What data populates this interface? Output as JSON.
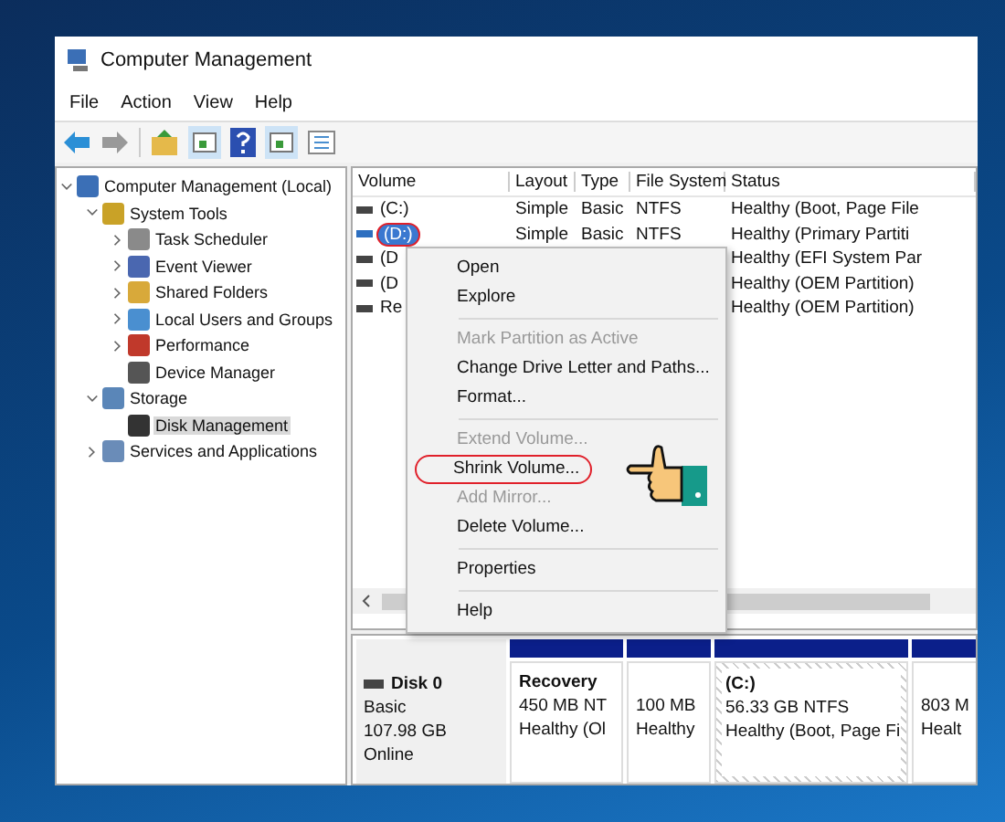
{
  "window": {
    "title": "Computer Management"
  },
  "menu": [
    "File",
    "Action",
    "View",
    "Help"
  ],
  "tree": [
    {
      "label": "Computer Management (Local)",
      "expanded": true,
      "selected": false,
      "children": [
        {
          "label": "System Tools",
          "expanded": true,
          "selected": false,
          "children": [
            {
              "label": "Task Scheduler",
              "expanded": false,
              "selected": false
            },
            {
              "label": "Event Viewer",
              "expanded": false,
              "selected": false
            },
            {
              "label": "Shared Folders",
              "expanded": false,
              "selected": false
            },
            {
              "label": "Local Users and Groups",
              "expanded": false,
              "selected": false
            },
            {
              "label": "Performance",
              "expanded": false,
              "selected": false
            },
            {
              "label": "Device Manager",
              "selected": false
            }
          ]
        },
        {
          "label": "Storage",
          "expanded": true,
          "selected": false,
          "children": [
            {
              "label": "Disk Management",
              "selected": true
            }
          ]
        },
        {
          "label": "Services and Applications",
          "expanded": false,
          "selected": false
        }
      ]
    }
  ],
  "table": {
    "columns": [
      "Volume",
      "Layout",
      "Type",
      "File System",
      "Status"
    ],
    "rows": [
      {
        "volume": "(C:)",
        "layout": "Simple",
        "type": "Basic",
        "file_system": "NTFS",
        "status": "Healthy (Boot, Page File",
        "selected": false,
        "circled": false
      },
      {
        "volume": "(D:)",
        "layout": "Simple",
        "type": "Basic",
        "file_system": "NTFS",
        "status": "Healthy (Primary Partiti",
        "selected": true,
        "circled": true
      },
      {
        "volume": "(D",
        "status": "Healthy (EFI System Par",
        "selected": false,
        "circled": false
      },
      {
        "volume": "(D",
        "status": "Healthy (OEM Partition)",
        "selected": false,
        "circled": false
      },
      {
        "volume": "Re",
        "status": "Healthy (OEM Partition)",
        "selected": false,
        "circled": false
      }
    ]
  },
  "context_menu": [
    {
      "kind": "item",
      "label": "Open",
      "disabled": false,
      "circled": false
    },
    {
      "kind": "item",
      "label": "Explore",
      "disabled": false,
      "circled": false
    },
    {
      "kind": "separator"
    },
    {
      "kind": "item",
      "label": "Mark Partition as Active",
      "disabled": true,
      "circled": false
    },
    {
      "kind": "item",
      "label": "Change Drive Letter and Paths...",
      "disabled": false,
      "circled": false
    },
    {
      "kind": "item",
      "label": "Format...",
      "disabled": false,
      "circled": false
    },
    {
      "kind": "separator"
    },
    {
      "kind": "item",
      "label": "Extend Volume...",
      "disabled": true,
      "circled": false
    },
    {
      "kind": "item",
      "label": "Shrink Volume...",
      "disabled": false,
      "circled": true
    },
    {
      "kind": "item",
      "label": "Add Mirror...",
      "disabled": true,
      "circled": false
    },
    {
      "kind": "item",
      "label": "Delete Volume...",
      "disabled": false,
      "circled": false
    },
    {
      "kind": "separator"
    },
    {
      "kind": "item",
      "label": "Properties",
      "disabled": false,
      "circled": false
    },
    {
      "kind": "separator"
    },
    {
      "kind": "item",
      "label": "Help",
      "disabled": false,
      "circled": false
    }
  ],
  "disk": {
    "name": "Disk 0",
    "lines": [
      "Basic",
      "107.98 GB",
      "Online"
    ],
    "partitions": [
      {
        "title": "Recovery",
        "lines": [
          "450 MB NT",
          "Healthy (Ol"
        ],
        "selected": false
      },
      {
        "lines": [
          "100 MB",
          "Healthy"
        ],
        "selected": false
      },
      {
        "title": "(C:)",
        "lines": [
          "56.33 GB NTFS",
          "Healthy (Boot, Page Fi"
        ],
        "selected": true
      },
      {
        "lines": [
          "803 M",
          "Healt"
        ],
        "selected": false
      }
    ]
  }
}
